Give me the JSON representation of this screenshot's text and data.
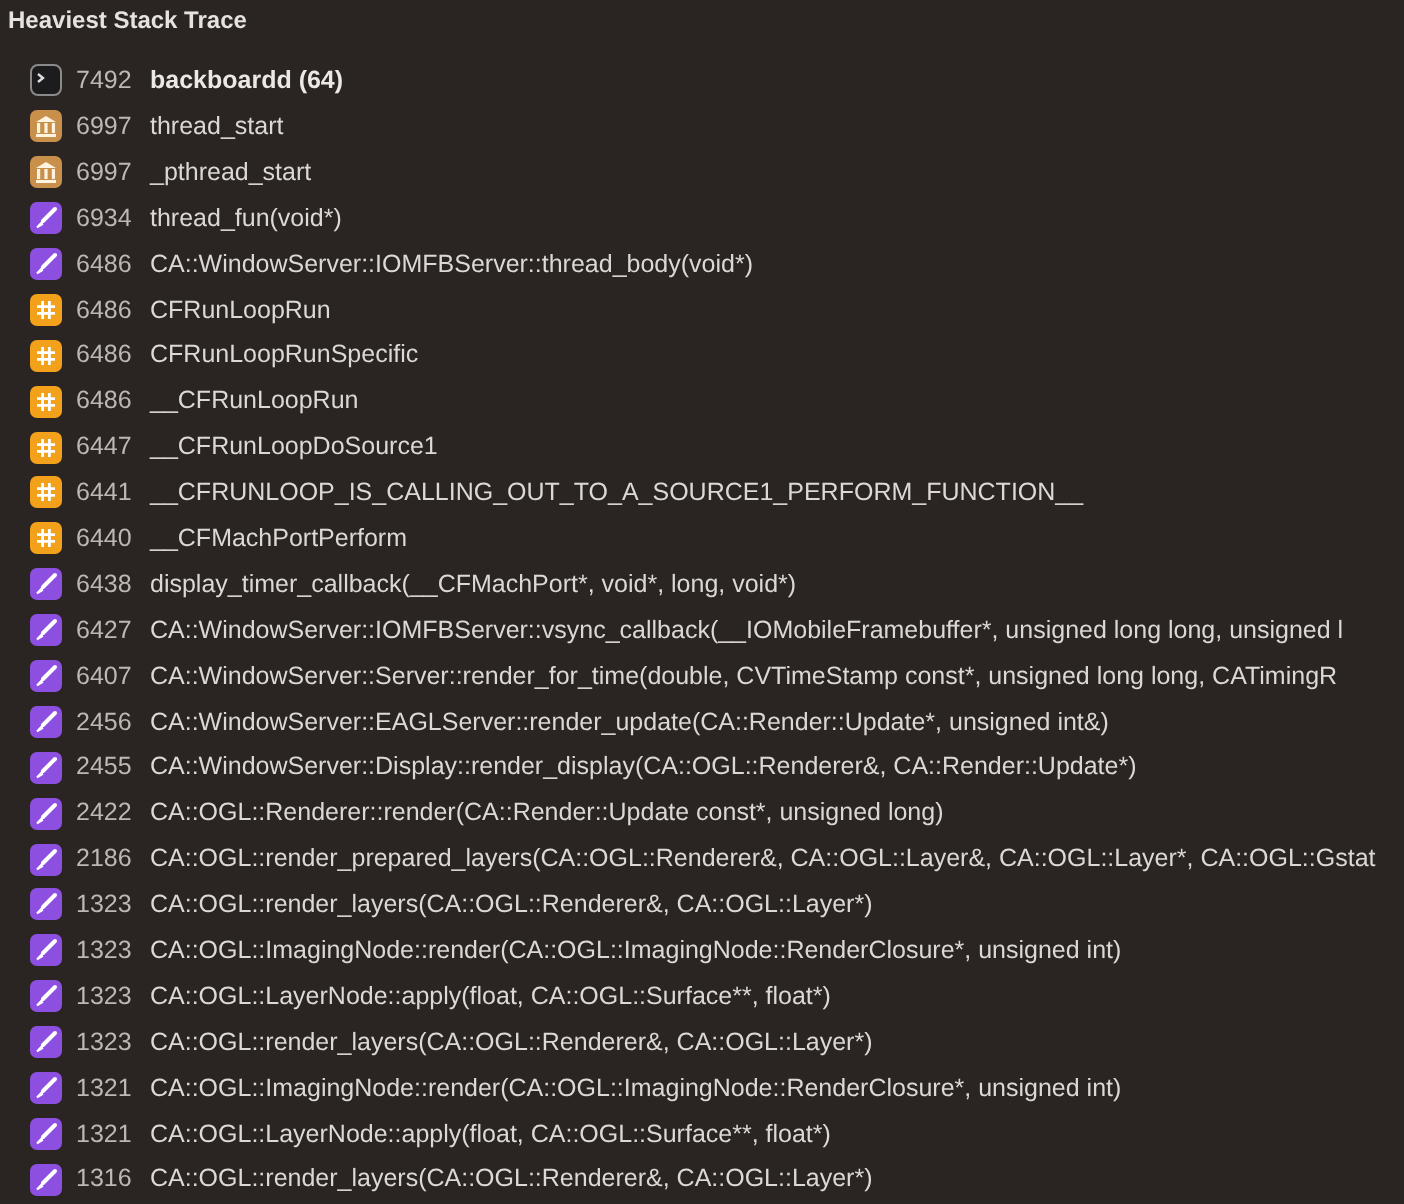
{
  "panel": {
    "title": "Heaviest Stack Trace"
  },
  "frames": [
    {
      "kind": "process",
      "count": "7492",
      "symbol": "backboardd (64)"
    },
    {
      "kind": "library",
      "count": "6997",
      "symbol": "thread_start"
    },
    {
      "kind": "library",
      "count": "6997",
      "symbol": "_pthread_start"
    },
    {
      "kind": "graphics",
      "count": "6934",
      "symbol": "thread_fun(void*)"
    },
    {
      "kind": "graphics",
      "count": "6486",
      "symbol": "CA::WindowServer::IOMFBServer::thread_body(void*)"
    },
    {
      "kind": "framework",
      "count": "6486",
      "symbol": "CFRunLoopRun"
    },
    {
      "kind": "framework",
      "count": "6486",
      "symbol": "CFRunLoopRunSpecific"
    },
    {
      "kind": "framework",
      "count": "6486",
      "symbol": "__CFRunLoopRun"
    },
    {
      "kind": "framework",
      "count": "6447",
      "symbol": "__CFRunLoopDoSource1"
    },
    {
      "kind": "framework",
      "count": "6441",
      "symbol": "__CFRUNLOOP_IS_CALLING_OUT_TO_A_SOURCE1_PERFORM_FUNCTION__"
    },
    {
      "kind": "framework",
      "count": "6440",
      "symbol": "__CFMachPortPerform"
    },
    {
      "kind": "graphics",
      "count": "6438",
      "symbol": "display_timer_callback(__CFMachPort*, void*, long, void*)"
    },
    {
      "kind": "graphics",
      "count": "6427",
      "symbol": "CA::WindowServer::IOMFBServer::vsync_callback(__IOMobileFramebuffer*, unsigned long long, unsigned l"
    },
    {
      "kind": "graphics",
      "count": "6407",
      "symbol": "CA::WindowServer::Server::render_for_time(double, CVTimeStamp const*, unsigned long long, CATimingR"
    },
    {
      "kind": "graphics",
      "count": "2456",
      "symbol": "CA::WindowServer::EAGLServer::render_update(CA::Render::Update*, unsigned int&)"
    },
    {
      "kind": "graphics",
      "count": "2455",
      "symbol": "CA::WindowServer::Display::render_display(CA::OGL::Renderer&, CA::Render::Update*)"
    },
    {
      "kind": "graphics",
      "count": "2422",
      "symbol": "CA::OGL::Renderer::render(CA::Render::Update const*, unsigned long)"
    },
    {
      "kind": "graphics",
      "count": "2186",
      "symbol": "CA::OGL::render_prepared_layers(CA::OGL::Renderer&, CA::OGL::Layer&, CA::OGL::Layer*, CA::OGL::Gstat"
    },
    {
      "kind": "graphics",
      "count": "1323",
      "symbol": "CA::OGL::render_layers(CA::OGL::Renderer&, CA::OGL::Layer*)"
    },
    {
      "kind": "graphics",
      "count": "1323",
      "symbol": "CA::OGL::ImagingNode::render(CA::OGL::ImagingNode::RenderClosure*, unsigned int)"
    },
    {
      "kind": "graphics",
      "count": "1323",
      "symbol": "CA::OGL::LayerNode::apply(float, CA::OGL::Surface**, float*)"
    },
    {
      "kind": "graphics",
      "count": "1323",
      "symbol": "CA::OGL::render_layers(CA::OGL::Renderer&, CA::OGL::Layer*)"
    },
    {
      "kind": "graphics",
      "count": "1321",
      "symbol": "CA::OGL::ImagingNode::render(CA::OGL::ImagingNode::RenderClosure*, unsigned int)"
    },
    {
      "kind": "graphics",
      "count": "1321",
      "symbol": "CA::OGL::LayerNode::apply(float, CA::OGL::Surface**, float*)"
    },
    {
      "kind": "graphics",
      "count": "1316",
      "symbol": "CA::OGL::render_layers(CA::OGL::Renderer&, CA::OGL::Layer*)"
    }
  ]
}
